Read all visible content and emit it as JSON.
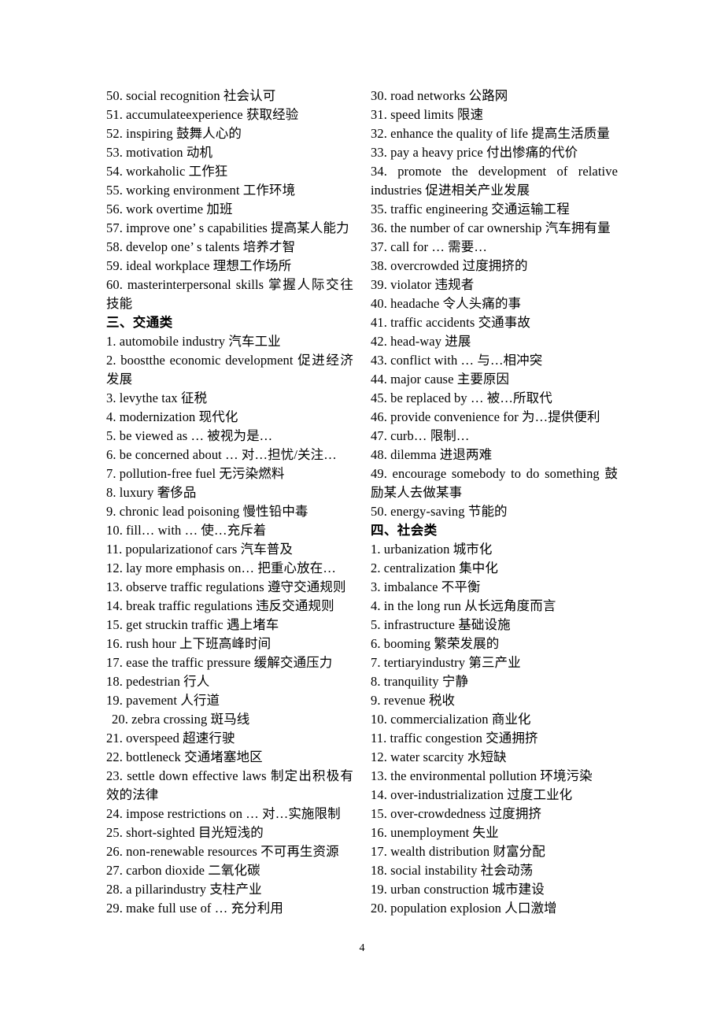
{
  "document": {
    "page_number": "4",
    "columns": [
      {
        "name": "left-column",
        "blocks": [
          {
            "type": "item",
            "text": "50. social recognition  社会认可"
          },
          {
            "type": "item",
            "text": "51. accumulateexperience  获取经验"
          },
          {
            "type": "item",
            "text": "52. inspiring  鼓舞人心的"
          },
          {
            "type": "item",
            "text": "53. motivation 动机"
          },
          {
            "type": "item",
            "text": "54. workaholic 工作狂"
          },
          {
            "type": "item",
            "text": "55. working environment  工作环境"
          },
          {
            "type": "item",
            "text": "56. work overtime  加班"
          },
          {
            "type": "item",
            "text": "57. improve one’ s capabilities  提高某人能力"
          },
          {
            "type": "item",
            "text": "58. develop one’ s talents  培养才智"
          },
          {
            "type": "item",
            "text": "59. ideal workplace  理想工作场所"
          },
          {
            "type": "item-wrap",
            "text": "60. masterinterpersonal skills  掌握人际交往技能"
          },
          {
            "type": "heading",
            "text": "三、交通类"
          },
          {
            "type": "item",
            "text": "1. automobile industry  汽车工业"
          },
          {
            "type": "item-wrap",
            "text": "2. boostthe economic development  促进经济发展"
          },
          {
            "type": "item",
            "text": "3. levythe tax  征税"
          },
          {
            "type": "item",
            "text": "4. modernization  现代化"
          },
          {
            "type": "item",
            "text": "5. be viewed as  …  被视为是…"
          },
          {
            "type": "item",
            "text": "6. be concerned about  …  对…担忧/关注…"
          },
          {
            "type": "item",
            "text": "7. pollution-free fuel  无污染燃料"
          },
          {
            "type": "item",
            "text": "8. luxury 奢侈品"
          },
          {
            "type": "item",
            "text": "9. chronic lead poisoning  慢性铅中毒"
          },
          {
            "type": "item",
            "text": "10. fill…  with  …  使…充斥着"
          },
          {
            "type": "item",
            "text": "11. popularizationof cars  汽车普及"
          },
          {
            "type": "item",
            "text": "12. lay more emphasis on…  把重心放在…"
          },
          {
            "type": "item",
            "text": "13. observe traffic regulations  遵守交通规则"
          },
          {
            "type": "item",
            "text": "14. break traffic regulations  违反交通规则"
          },
          {
            "type": "item",
            "text": "15. get struckin traffic  遇上堵车"
          },
          {
            "type": "item",
            "text": "16. rush hour  上下班高峰时间"
          },
          {
            "type": "item",
            "text": "17. ease the traffic pressure  缓解交通压力"
          },
          {
            "type": "item",
            "text": "18. pedestrian 行人"
          },
          {
            "type": "item",
            "text": "19. pavement 人行道"
          },
          {
            "type": "item-indent",
            "text": "20. zebra crossing  斑马线"
          },
          {
            "type": "item",
            "text": "21. overspeed  超速行驶"
          },
          {
            "type": "item",
            "text": "22. bottleneck 交通堵塞地区"
          },
          {
            "type": "item-wrap",
            "text": "23. settle down effective laws  制定出积极有效的法律"
          },
          {
            "type": "item",
            "text": "24. impose restrictions on  …  对…实施限制"
          },
          {
            "type": "item",
            "text": "25. short-sighted  目光短浅的"
          },
          {
            "type": "item",
            "text": "26. non-renewable resources  不可再生资源"
          },
          {
            "type": "item",
            "text": "27. carbon dioxide 二氧化碳"
          },
          {
            "type": "item",
            "text": "28. a pillarindustry  支柱产业"
          },
          {
            "type": "item",
            "text": "29. make full use of  …  充分利用"
          }
        ]
      },
      {
        "name": "right-column",
        "blocks": [
          {
            "type": "item",
            "text": "30. road networks  公路网"
          },
          {
            "type": "item",
            "text": "31. speed limits  限速"
          },
          {
            "type": "item",
            "text": "32. enhance the quality of life  提高生活质量"
          },
          {
            "type": "item",
            "text": "33. pay a heavy price  付出惨痛的代价"
          },
          {
            "type": "item-wrap-spread",
            "text": "34.  promote  the  development  of  relative industries  促进相关产业发展"
          },
          {
            "type": "item",
            "text": "35. traffic engineering  交通运输工程"
          },
          {
            "type": "item",
            "text": "36. the number of car ownership  汽车拥有量"
          },
          {
            "type": "item",
            "text": "37. call for  …  需要…"
          },
          {
            "type": "item",
            "text": "38. overcrowded  过度拥挤的"
          },
          {
            "type": "item",
            "text": "39. violator 违规者"
          },
          {
            "type": "item",
            "text": "40. headache  令人头痛的事"
          },
          {
            "type": "item",
            "text": "41. traffic accidents  交通事故"
          },
          {
            "type": "item",
            "text": "42. head-way  进展"
          },
          {
            "type": "item",
            "text": "43. conflict with  …  与…相冲突"
          },
          {
            "type": "item",
            "text": "44. major cause  主要原因"
          },
          {
            "type": "item",
            "text": "45. be replaced by  …  被…所取代"
          },
          {
            "type": "item",
            "text": "46. provide convenience for   为…提供便利"
          },
          {
            "type": "item",
            "text": "47. curb…  限制…"
          },
          {
            "type": "item",
            "text": "48. dilemma 进退两难"
          },
          {
            "type": "item-wrap-spread",
            "text": "49.  encourage  somebody  to  do  something  鼓励某人去做某事"
          },
          {
            "type": "item",
            "text": "50. energy-saving  节能的"
          },
          {
            "type": "heading",
            "text": "四、社会类"
          },
          {
            "type": "item",
            "text": "1. urbanization  城市化"
          },
          {
            "type": "item",
            "text": "2. centralization 集中化"
          },
          {
            "type": "item",
            "text": "3. imbalance  不平衡"
          },
          {
            "type": "item",
            "text": "4. in the long run  从长远角度而言"
          },
          {
            "type": "item",
            "text": "5. infrastructure 基础设施"
          },
          {
            "type": "item",
            "text": "6. booming  繁荣发展的"
          },
          {
            "type": "item",
            "text": "7. tertiaryindustry  第三产业"
          },
          {
            "type": "item",
            "text": "8. tranquility 宁静"
          },
          {
            "type": "item",
            "text": "9. revenue  税收"
          },
          {
            "type": "item",
            "text": "10. commercialization  商业化"
          },
          {
            "type": "item",
            "text": "11. traffic congestion  交通拥挤"
          },
          {
            "type": "item",
            "text": "12. water scarcity  水短缺"
          },
          {
            "type": "item",
            "text": "13. the environmental pollution  环境污染"
          },
          {
            "type": "item",
            "text": "14. over-industrialization  过度工业化"
          },
          {
            "type": "item",
            "text": "15. over-crowdedness  过度拥挤"
          },
          {
            "type": "item",
            "text": "16. unemployment  失业"
          },
          {
            "type": "item",
            "text": "17. wealth distribution 财富分配"
          },
          {
            "type": "item",
            "text": "18. social instability  社会动荡"
          },
          {
            "type": "item",
            "text": "19. urban construction  城市建设"
          },
          {
            "type": "item",
            "text": "20. population explosion  人口激增"
          }
        ]
      }
    ]
  }
}
